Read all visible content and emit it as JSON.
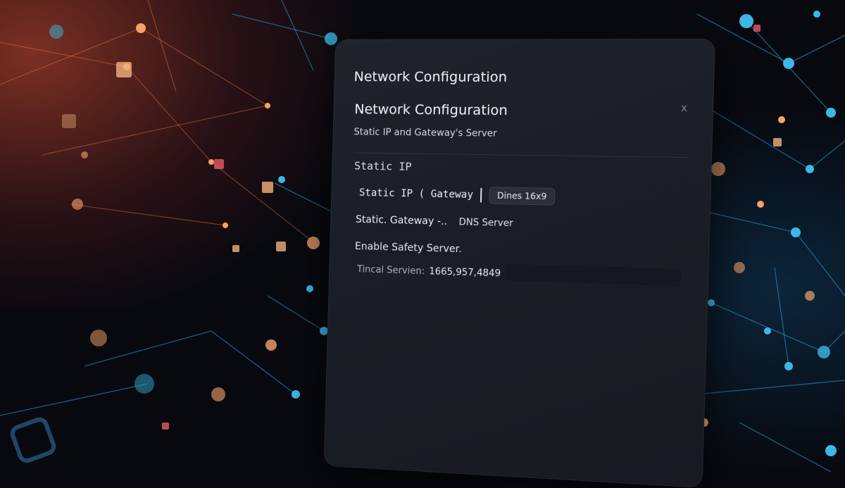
{
  "dialog": {
    "window_title": "Network Configuration",
    "title": "Network Configuration",
    "subtitle": "Static IP and Gateway's Server",
    "close_label": "x"
  },
  "form": {
    "section_label": "Static IP",
    "static_ip_label": "Static IP ( Gateway",
    "dns_chip": "Dines 16x9",
    "gateway_label": "Static. Gateway -..",
    "dns_server_label": "DNS Server",
    "enable_safety_label": "Enable Safety Server.",
    "tincal_label": "Tincal Servien:",
    "tincal_value": "1665,957,4849"
  }
}
